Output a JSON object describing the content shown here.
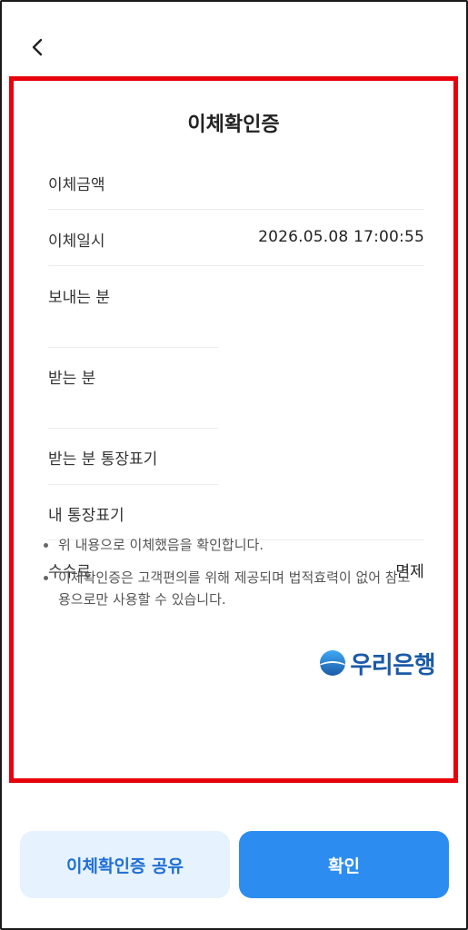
{
  "header": {
    "back_icon": "chevron-left-icon"
  },
  "receipt": {
    "title": "이체확인증",
    "rows": [
      {
        "label": "이체금액",
        "value": ""
      },
      {
        "label": "이체일시",
        "value": "2026.05.08 17:00:55"
      },
      {
        "label": "보내는 분",
        "value": ""
      },
      {
        "label": "받는 분",
        "value": ""
      },
      {
        "label": "받는 분 통장표기",
        "value": ""
      },
      {
        "label": "내 통장표기",
        "value": ""
      },
      {
        "label": "수수료",
        "value": "면제"
      }
    ],
    "notes": [
      "위 내용으로 이체했음을 확인합니다.",
      "이체확인증은 고객편의를 위해 제공되며 법적효력이 없어 참고용으로만 사용할 수 있습니다."
    ],
    "bank_logo_text": "우리은행",
    "logo_color": "#1b5aa6",
    "border_color": "#e8000b"
  },
  "actions": {
    "share_label": "이체확인증 공유",
    "confirm_label": "확인"
  }
}
